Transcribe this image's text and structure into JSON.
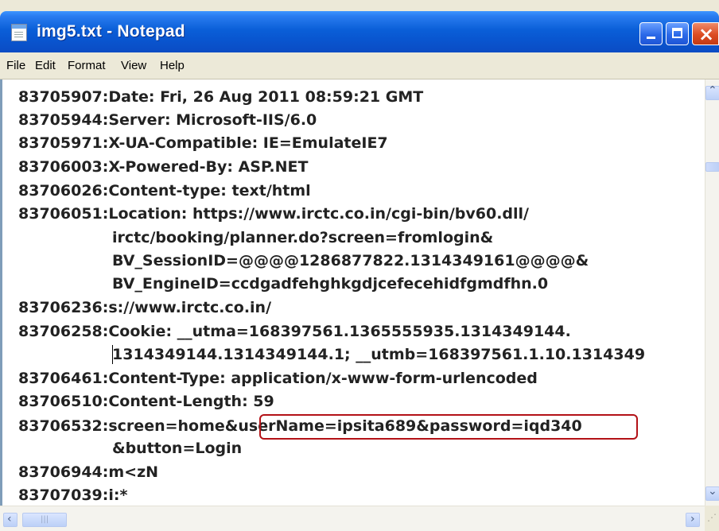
{
  "window": {
    "title": "img5.txt - Notepad",
    "icon": "notepad-icon"
  },
  "menu": [
    "File",
    "Edit",
    "Format",
    "View",
    "Help"
  ],
  "lines": [
    {
      "text": "83705907:Date: Fri, 26 Aug 2011 08:59:21 GMT",
      "indent": false
    },
    {
      "text": "83705944:Server: Microsoft-IIS/6.0",
      "indent": false
    },
    {
      "text": "83705971:X-UA-Compatible: IE=EmulateIE7",
      "indent": false
    },
    {
      "text": "83706003:X-Powered-By: ASP.NET",
      "indent": false
    },
    {
      "text": "83706026:Content-type: text/html",
      "indent": false
    },
    {
      "text": "83706051:Location: https://www.irctc.co.in/cgi-bin/bv60.dll/",
      "indent": false
    },
    {
      "text": "irctc/booking/planner.do?screen=fromlogin&",
      "indent": true
    },
    {
      "text": "BV_SessionID=@@@@1286877822.1314349161@@@@&",
      "indent": true
    },
    {
      "text": "BV_EngineID=ccdgadfehghkgdjcefecehidfgmdfhn.0",
      "indent": true
    },
    {
      "text": "83706236:s://www.irctc.co.in/",
      "indent": false
    },
    {
      "text": "83706258:Cookie: __utma=168397561.1365555935.1314349144.",
      "indent": false
    },
    {
      "text": "1314349144.1314349144.1; __utmb=168397561.1.10.1314349",
      "indent": true
    },
    {
      "text": "83706461:Content-Type: application/x-www-form-urlencoded",
      "indent": false
    },
    {
      "text": "83706510:Content-Length: 59",
      "indent": false
    },
    {
      "text": "83706532:screen=home&userName=ipsita689&password=iqd340",
      "indent": false
    },
    {
      "text": "&button=Login",
      "indent": true
    },
    {
      "text": "83706944:m<zN",
      "indent": false
    },
    {
      "text": "83707039:i:*",
      "indent": false
    }
  ],
  "highlighted_text": "userName=ipsita689&password=iqd340",
  "colors": {
    "titlebar": "#0955cf",
    "highlight_border": "#b31217",
    "close_button": "#dc4c22"
  }
}
